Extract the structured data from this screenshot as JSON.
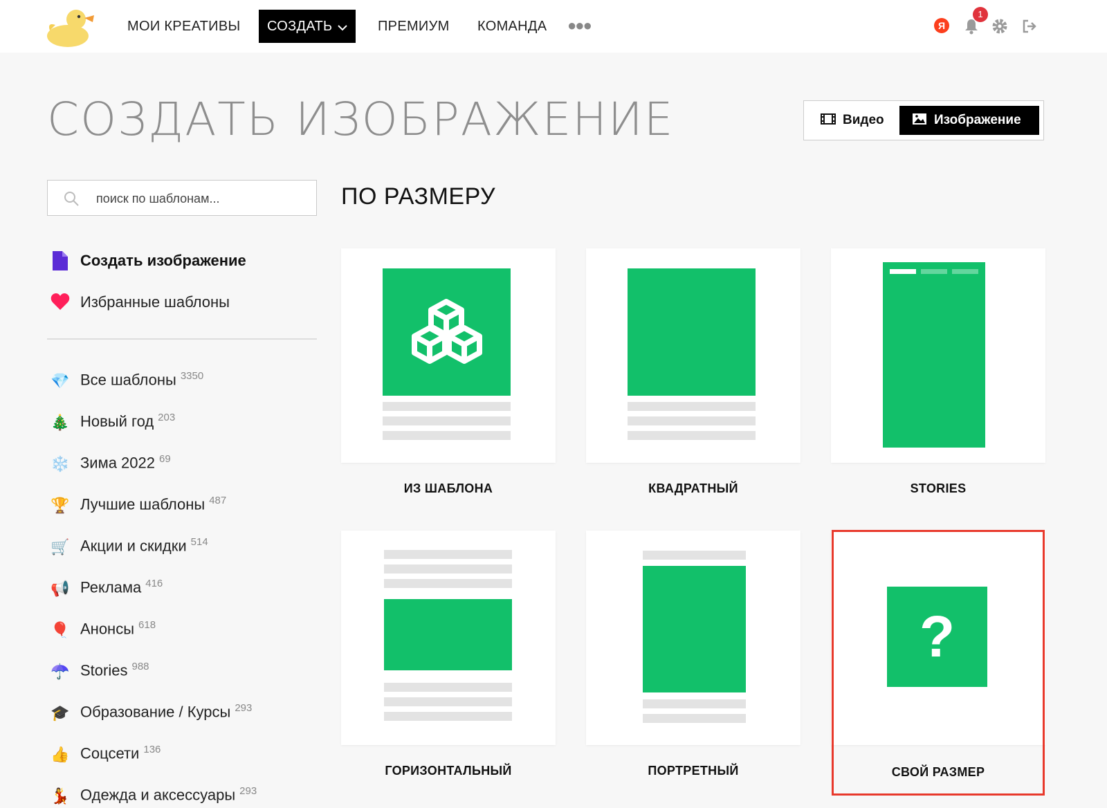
{
  "nav": {
    "my_creatives": "МОИ КРЕАТИВЫ",
    "create": "СОЗДАТЬ",
    "premium": "ПРЕМИУМ",
    "team": "КОМАНДА",
    "more": "●●●",
    "yandex_label": "Я",
    "notifications_count": "1"
  },
  "page": {
    "title": "СОЗДАТЬ ИЗОБРАЖЕНИЕ",
    "mode_video": "Видео",
    "mode_image": "Изображение",
    "active_mode": "Изображение"
  },
  "search": {
    "placeholder": "поиск по шаблонам..."
  },
  "sidebar": {
    "primary": [
      {
        "label": "Создать изображение",
        "icon": "document-icon",
        "active": true
      },
      {
        "label": "Избранные шаблоны",
        "icon": "heart-icon"
      }
    ],
    "categories": [
      {
        "label": "Все шаблоны",
        "count": "3350",
        "icon": "💎"
      },
      {
        "label": "Новый год",
        "count": "203",
        "icon": "🎄"
      },
      {
        "label": "Зима 2022",
        "count": "69",
        "icon": "❄️"
      },
      {
        "label": "Лучшие шаблоны",
        "count": "487",
        "icon": "🏆"
      },
      {
        "label": "Акции и скидки",
        "count": "514",
        "icon": "🛒"
      },
      {
        "label": "Реклама",
        "count": "416",
        "icon": "📢"
      },
      {
        "label": "Анонсы",
        "count": "618",
        "icon": "🎈"
      },
      {
        "label": "Stories",
        "count": "988",
        "icon": "☂️"
      },
      {
        "label": "Образование / Курсы",
        "count": "293",
        "icon": "🎓"
      },
      {
        "label": "Соцсети",
        "count": "136",
        "icon": "👍"
      },
      {
        "label": "Одежда и аксессуары",
        "count": "293",
        "icon": "💃"
      }
    ]
  },
  "main": {
    "section_title": "ПО РАЗМЕРУ",
    "cards": [
      {
        "label": "ИЗ ШАБЛОНА"
      },
      {
        "label": "КВАДРАТНЫЙ"
      },
      {
        "label": "STORIES"
      },
      {
        "label": "ГОРИЗОНТАЛЬНЫЙ"
      },
      {
        "label": "ПОРТРЕТНЫЙ"
      },
      {
        "label": "СВОЙ РАЗМЕР",
        "highlighted": true,
        "glyph": "?"
      }
    ]
  },
  "colors": {
    "accent_green": "#12c06a",
    "highlight_red": "#e8392c",
    "heart_pink": "#ff1f5a",
    "doc_purple": "#5b2bd6"
  }
}
